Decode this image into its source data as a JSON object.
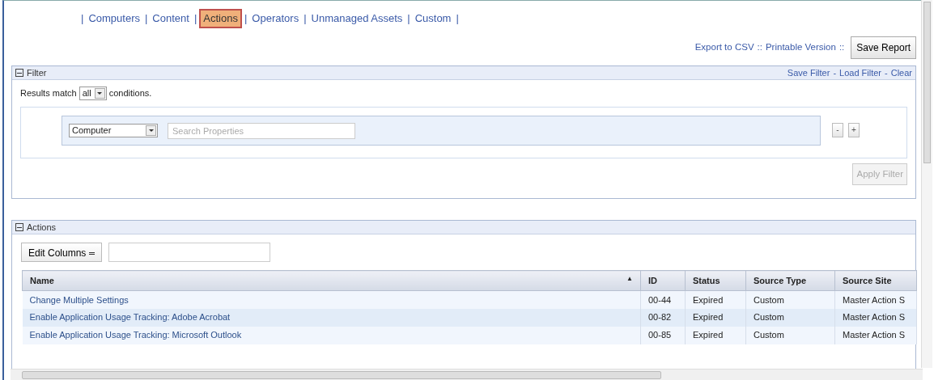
{
  "tabs": [
    {
      "label": "Computers",
      "selected": false
    },
    {
      "label": "Content",
      "selected": false
    },
    {
      "label": "Actions",
      "selected": true
    },
    {
      "label": "Operators",
      "selected": false
    },
    {
      "label": "Unmanaged Assets",
      "selected": false
    },
    {
      "label": "Custom",
      "selected": false
    }
  ],
  "tab_separator": "|",
  "report_links": [
    {
      "label": "Export to CSV"
    },
    {
      "label": "Printable Version"
    }
  ],
  "link_separator": "::",
  "save_button": "Save Report",
  "filter": {
    "title": "Filter",
    "expanded": true,
    "links": [
      "Save Filter",
      "Load Filter",
      "Clear"
    ],
    "link_separator": "-",
    "match_prefix": "Results match",
    "match_value": "all",
    "match_suffix": "conditions.",
    "property_select": "Computer",
    "search_placeholder": "Search Properties",
    "remove_button": "-",
    "add_button": "+",
    "apply_button": "Apply Filter",
    "apply_disabled": true
  },
  "actions": {
    "title": "Actions",
    "expanded": true,
    "edit_columns": "Edit Columns",
    "sort_mark": "▲",
    "table": {
      "columns": [
        {
          "label": "Name",
          "sorted": true
        },
        {
          "label": "ID",
          "sorted": false
        },
        {
          "label": "Status",
          "sorted": false
        },
        {
          "label": "Source Type",
          "sorted": false
        },
        {
          "label": "Source Site",
          "sorted": false
        }
      ],
      "rows": [
        [
          "Change Multiple Settings",
          "00-44",
          "Expired",
          "Custom",
          "Master Action S"
        ],
        [
          "Enable Application Usage Tracking: Adobe Acrobat",
          "00-82",
          "Expired",
          "Custom",
          "Master Action S"
        ],
        [
          "Enable Application Usage Tracking: Microsoft Outlook",
          "00-85",
          "Expired",
          "Custom",
          "Master Action S"
        ]
      ]
    }
  }
}
